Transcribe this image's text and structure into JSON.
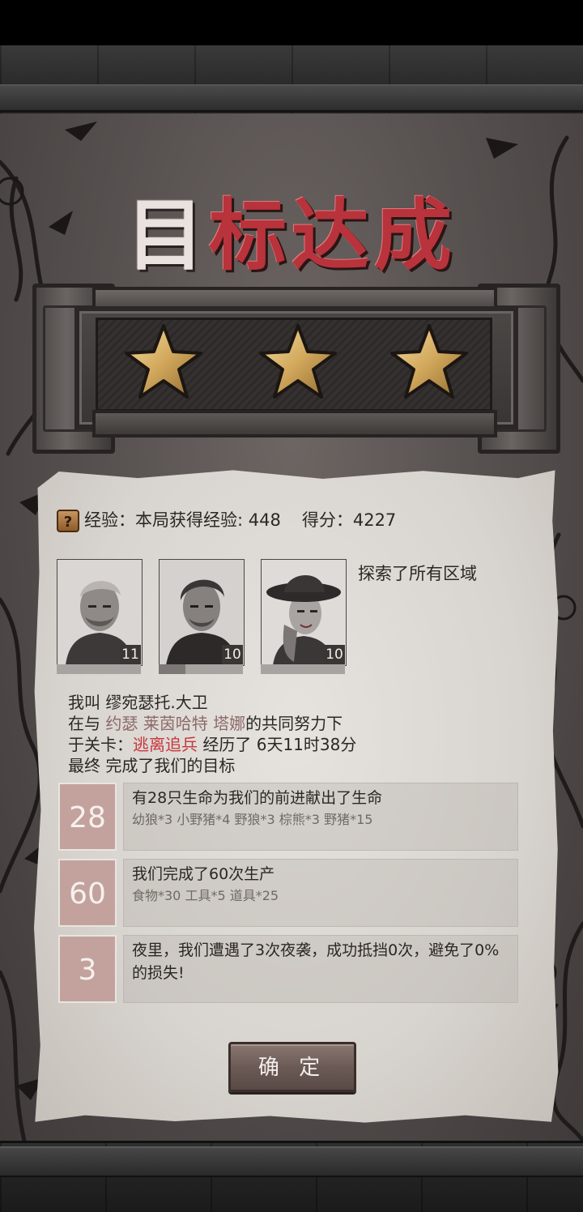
{
  "title": {
    "part1": "目",
    "part2": "标达成"
  },
  "stars": {
    "earned": 3,
    "total": 3
  },
  "experience": {
    "help_icon": "?",
    "label": "经验：本局获得经验: 448",
    "score_label": "得分：4227"
  },
  "team": [
    {
      "name": "缪宛瑟托.大卫",
      "level": "11",
      "exp_fill": 0.0
    },
    {
      "name": "约瑟",
      "level": "10",
      "exp_fill": 0.32
    },
    {
      "name": "莱茵哈特",
      "level": "10",
      "exp_fill": 0.0
    }
  ],
  "achievement": "探索了所有区域",
  "story": {
    "line1_prefix": "我叫 缪宛瑟托.大卫",
    "line2_prefix": "在与 ",
    "line2_names": "约瑟 莱茵哈特 塔娜",
    "line2_suffix": "的共同努力下",
    "line3_prefix": "于关卡：",
    "line3_stage": "逃离追兵",
    "line3_suffix": " 经历了 6天11时38分",
    "line4": "最终 完成了我们的目标"
  },
  "stats": [
    {
      "num": "28",
      "main": "有28只生命为我们的前进献出了生命",
      "sub": "幼狼*3  小野猪*4  野狼*3  棕熊*3  野猪*15"
    },
    {
      "num": "60",
      "main": "我们完成了60次生产",
      "sub": "食物*30    工具*5    道具*25"
    },
    {
      "num": "3",
      "main": "夜里，我们遭遇了3次夜袭，成功抵挡0次，避免了0%的损失!",
      "sub": ""
    }
  ],
  "confirm_button": "确 定",
  "colors": {
    "title_white": "#e9e2df",
    "title_red": "#b8333b",
    "stage_red": "#c7363c",
    "names_brown": "#8c6a68",
    "number_bg": "#c3a29e",
    "parchment": "#e0dcd7"
  }
}
